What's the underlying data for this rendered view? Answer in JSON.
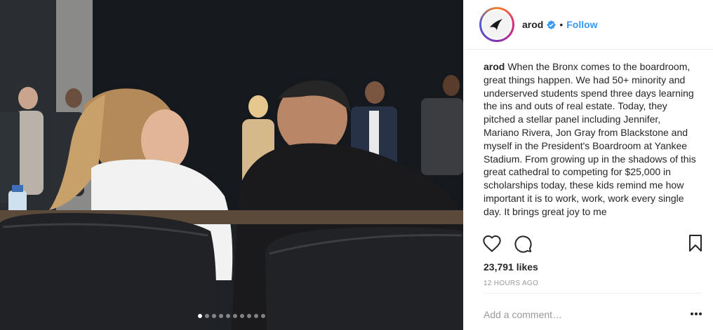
{
  "post": {
    "username": "arod",
    "follow_label": "Follow",
    "separator": "•",
    "caption_user": "arod",
    "caption_text": "When the Bronx comes to the boardroom, great things happen. We had 50+ minority and underserved students spend three days learning the ins and outs of real estate. Today, they pitched a stellar panel including Jennifer, Mariano Rivera, Jon Gray from Blackstone and myself in the President's Boardroom at Yankee Stadium. From growing up in the shadows of this great cathedral to competing for $25,000 in scholarships today, these kids remind me how important it is to work, work, work every single day. It brings great joy to me",
    "likes": "23,791 likes",
    "time": "12 HOURS AGO",
    "comment_placeholder": "Add a comment…",
    "more_label": "•••"
  },
  "carousel": {
    "total": 10,
    "active": 0
  },
  "icons": {
    "verified": "verified-badge-icon",
    "like": "heart-icon",
    "comment": "comment-bubble-icon",
    "save": "bookmark-icon",
    "more": "more-options-icon",
    "avatar": "avatar-logo-icon"
  },
  "colors": {
    "link": "#3897f0",
    "text": "#262626",
    "muted": "#999999",
    "verified": "#3897f0"
  }
}
